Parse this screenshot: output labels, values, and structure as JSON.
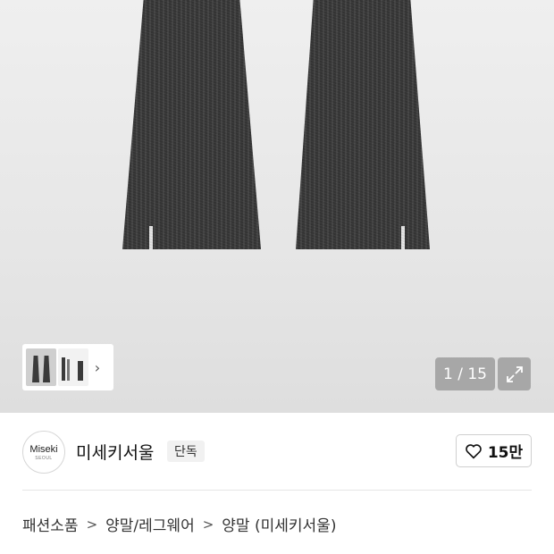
{
  "gallery": {
    "counter": "1 / 15",
    "thumbnails": [
      "thumbnail-1",
      "thumbnail-2"
    ],
    "thumb_next_icon": "chevron-right-icon",
    "expand_icon": "expand-icon"
  },
  "seller": {
    "logo_name": "Miseki",
    "logo_sub": "SEOUL",
    "name": "미세키서울",
    "badge": "단독"
  },
  "like": {
    "icon": "heart-icon",
    "count": "15만"
  },
  "breadcrumb": {
    "items": [
      "패션소품",
      "양말/레그웨어",
      "양말 (미세키서울)"
    ],
    "separator": ">"
  }
}
